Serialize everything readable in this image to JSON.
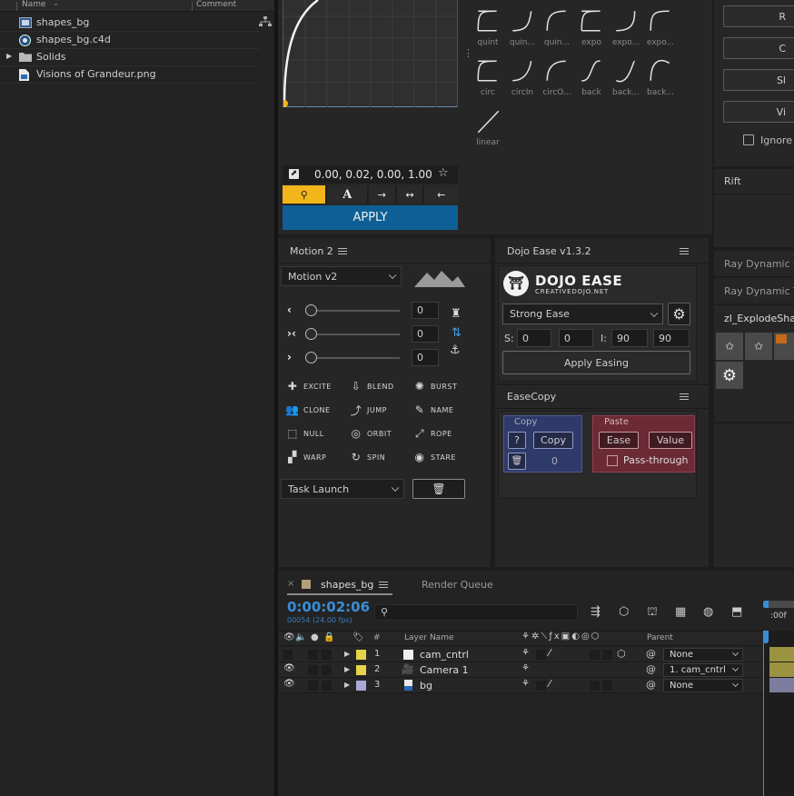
{
  "project": {
    "col_name": "Name",
    "col_comment": "Comment",
    "items": [
      {
        "label": "shapes_bg",
        "icon": "composition-icon"
      },
      {
        "label": "shapes_bg.c4d",
        "icon": "c4d-file-icon"
      },
      {
        "label": "Solids",
        "icon": "folder-icon"
      },
      {
        "label": "Visions of Grandeur.png",
        "icon": "image-file-icon"
      }
    ]
  },
  "flow": {
    "bezier_value": "0.00, 0.02, 0.00, 1.00",
    "apply_label": "APPLY",
    "presets": [
      "quint",
      "quin...",
      "quin...",
      "expo",
      "expo...",
      "expo...",
      "circ",
      "circIn",
      "circO...",
      "back",
      "back...",
      "back...",
      "linear"
    ]
  },
  "right_panel": {
    "ignore_label": "Ignore",
    "buttons": [
      "R",
      "C",
      "Sl",
      "Vi"
    ],
    "rift_label": "Rift",
    "ray1": "Ray Dynamic C",
    "ray2": "Ray Dynamic Te",
    "zl_label": "zl_ExplodeShap"
  },
  "motion": {
    "title": "Motion 2",
    "version_select": "Motion v2",
    "sliders": [
      {
        "value": "0"
      },
      {
        "value": "0"
      },
      {
        "value": "0"
      }
    ],
    "tools": [
      "EXCITE",
      "BLEND",
      "BURST",
      "CLONE",
      "JUMP",
      "NAME",
      "NULL",
      "ORBIT",
      "ROPE",
      "WARP",
      "SPIN",
      "STARE"
    ],
    "task_select": "Task Launch"
  },
  "dojo": {
    "title": "Dojo Ease v1.3.2",
    "logo_title": "DOJO EASE",
    "logo_sub": "CREATIVEDOJO.NET",
    "ease_select": "Strong Ease",
    "s_label": "S:",
    "s1": "0",
    "s2": "0",
    "i_label": "I:",
    "i1": "90",
    "i2": "90",
    "apply_label": "Apply Easing"
  },
  "easecopy": {
    "title": "EaseCopy",
    "copy_group": "Copy",
    "q_label": "?",
    "copy_btn": "Copy",
    "count": "0",
    "paste_group": "Paste",
    "ease_btn": "Ease",
    "value_btn": "Value",
    "pass_label": "Pass-through"
  },
  "timeline": {
    "tab_comp": "shapes_bg",
    "tab_render": "Render Queue",
    "timecode": "0:00:02:06",
    "frame_info": "00054 (24.00 fps)",
    "ruler_label": ":00f",
    "col_hash": "#",
    "col_layer": "Layer Name",
    "col_parent": "Parent",
    "layers": [
      {
        "num": "1",
        "name": "cam_cntrl",
        "parent": "None",
        "label_color": "#e6d34a"
      },
      {
        "num": "2",
        "name": "Camera 1",
        "parent": "1. cam_cntrl",
        "label_color": "#e6d34a"
      },
      {
        "num": "3",
        "name": "bg",
        "parent": "None",
        "label_color": "#a9a9d6"
      }
    ]
  },
  "colors": {
    "accent_blue": "#0e5f96",
    "accent_yellow": "#f2b51a",
    "timecode_blue": "#3a8ed8"
  }
}
